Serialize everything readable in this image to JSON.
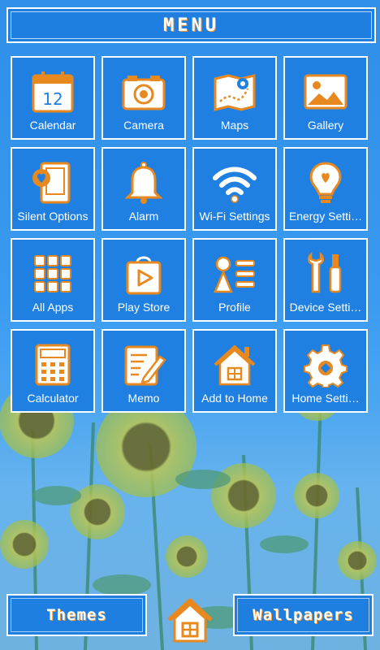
{
  "header": {
    "title": "MENU"
  },
  "tiles": [
    {
      "label": "Calendar",
      "icon": "calendar-icon",
      "day": "12"
    },
    {
      "label": "Camera",
      "icon": "camera-icon"
    },
    {
      "label": "Maps",
      "icon": "map-icon"
    },
    {
      "label": "Gallery",
      "icon": "gallery-icon"
    },
    {
      "label": "Silent Options",
      "icon": "silent-phone-icon"
    },
    {
      "label": "Alarm",
      "icon": "bell-icon"
    },
    {
      "label": "Wi-Fi Settings",
      "icon": "wifi-icon"
    },
    {
      "label": "Energy Setti…",
      "icon": "lightbulb-icon"
    },
    {
      "label": "All Apps",
      "icon": "apps-grid-icon"
    },
    {
      "label": "Play Store",
      "icon": "play-store-icon"
    },
    {
      "label": "Profile",
      "icon": "profile-icon"
    },
    {
      "label": "Device Setti…",
      "icon": "tools-icon"
    },
    {
      "label": "Calculator",
      "icon": "calculator-icon"
    },
    {
      "label": "Memo",
      "icon": "memo-icon"
    },
    {
      "label": "Add to Home",
      "icon": "house-icon"
    },
    {
      "label": "Home Setti…",
      "icon": "gear-icon"
    }
  ],
  "footer": {
    "themes_label": "Themes",
    "wallpapers_label": "Wallpapers",
    "home_icon": "house-icon"
  },
  "colors": {
    "tile_blue": "#1f80e2",
    "icon_orange": "#e8891f",
    "white": "#ffffff"
  }
}
